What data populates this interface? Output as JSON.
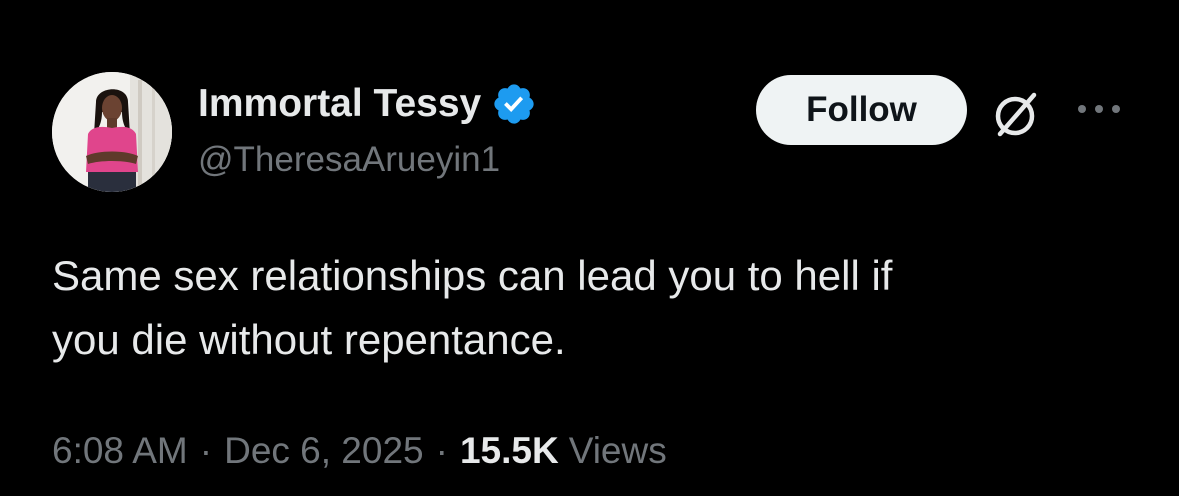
{
  "author": {
    "display_name": "Immortal Tessy",
    "handle": "@TheresaArueyin1",
    "verified": true,
    "verified_color": "#1d9bf0"
  },
  "actions": {
    "follow_label": "Follow",
    "grok_icon": "grok-slash-circle-icon",
    "more_icon": "more-horizontal-icon"
  },
  "tweet": {
    "text_line1": "Same sex relationships can lead you to hell if",
    "text_line2": "you die without repentance."
  },
  "meta": {
    "time": "6:08 AM",
    "separator": "·",
    "date": "Dec 6, 2025",
    "views_count": "15.5K",
    "views_label": "Views"
  },
  "colors": {
    "background": "#000000",
    "primary_text": "#e7e9ea",
    "secondary_text": "#71767b",
    "follow_bg": "#eff3f4",
    "follow_text": "#0f1419"
  }
}
